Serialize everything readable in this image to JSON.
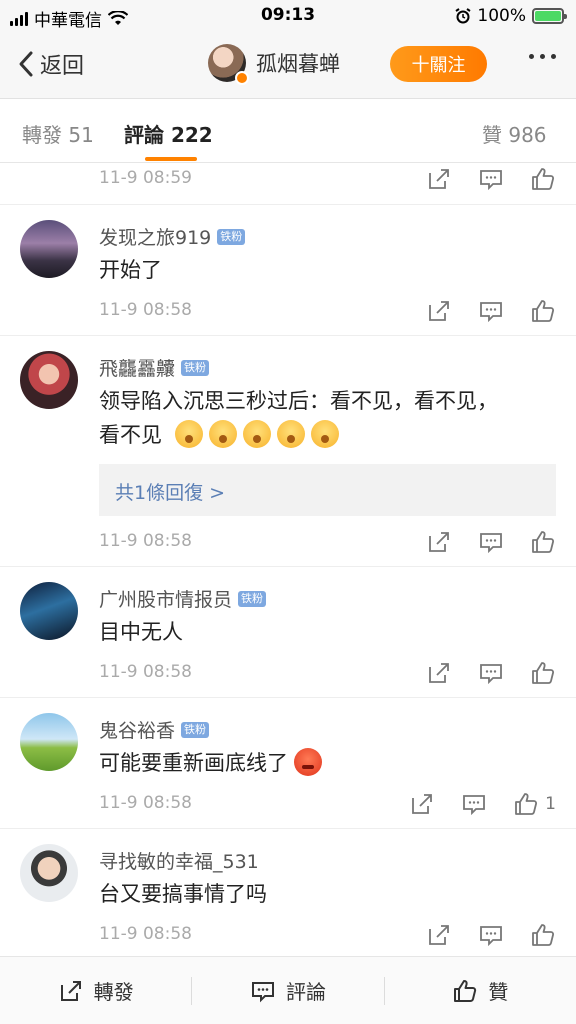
{
  "status_bar": {
    "carrier": "中華電信",
    "time": "09:13",
    "battery": "100%",
    "icons": [
      "signal-icon",
      "wifi-icon",
      "alarm-icon",
      "battery-icon"
    ]
  },
  "nav": {
    "back_label": "返回",
    "username": "孤烟暮蝉",
    "follow_label": "十關注",
    "more_icon": "more-dots-icon"
  },
  "tabs": {
    "reposts_label": "轉發",
    "reposts_count": "51",
    "comments_label": "評論",
    "comments_count": "222",
    "likes_label": "贊",
    "likes_count": "986"
  },
  "top_strip": {
    "time": "11-9 08:59"
  },
  "comments": [
    {
      "name": "发现之旅919",
      "badge": "铁粉",
      "text": "开始了",
      "time": "11-9 08:58",
      "likes": ""
    },
    {
      "name": "飛龘靐齉",
      "badge": "铁粉",
      "text_line1": "领导陷入沉思三秒过后：看不见，看不见，",
      "text_line2": "看不见",
      "reply_label": "共1條回復 >",
      "time": "11-9 08:58",
      "likes": ""
    },
    {
      "name": "广州股市情报员",
      "badge": "铁粉",
      "text": "目中无人",
      "time": "11-9 08:58",
      "likes": ""
    },
    {
      "name": "鬼谷裕香",
      "badge": "铁粉",
      "text": "可能要重新画底线了",
      "time": "11-9 08:58",
      "likes": "1"
    },
    {
      "name": "寻找敏的幸福_531",
      "text": "台又要搞事情了吗",
      "time": "11-9 08:58",
      "likes": ""
    }
  ],
  "bottom_bar": {
    "repost_label": "轉發",
    "comment_label": "評論",
    "like_label": "贊"
  },
  "colors": {
    "accent": "#ff8200",
    "link": "#5b7fb5",
    "fan_badge": "#7ea8e0"
  }
}
